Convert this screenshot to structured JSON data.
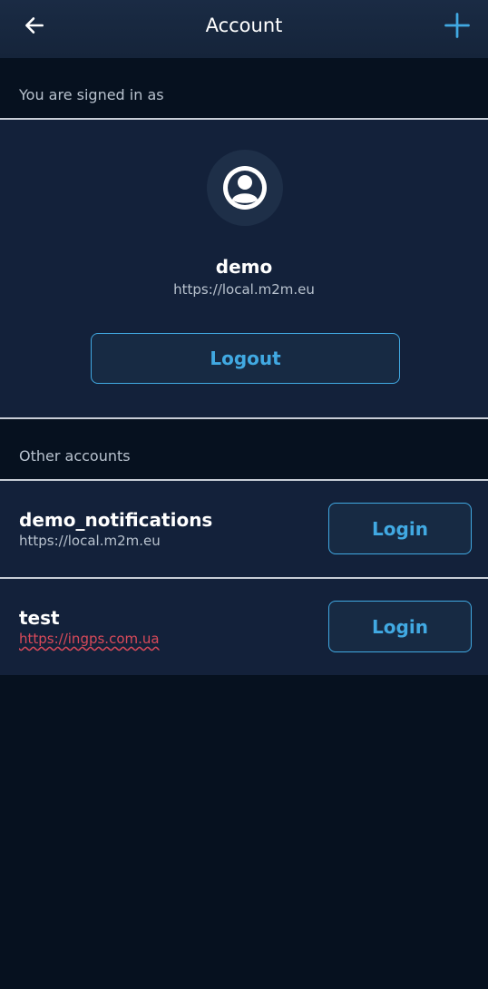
{
  "app_bar": {
    "title": "Account",
    "back_icon": "arrow-left-icon",
    "add_icon": "plus-icon"
  },
  "signed_in": {
    "header": "You are signed in as",
    "avatar_icon": "account-circle-icon",
    "name": "demo",
    "url": "https://local.m2m.eu",
    "logout_label": "Logout"
  },
  "other_accounts": {
    "header": "Other accounts",
    "items": [
      {
        "name": "demo_notifications",
        "url": "https://local.m2m.eu",
        "login_label": "Login"
      },
      {
        "name": "test",
        "url": "https://ingps.com.ua",
        "login_label": "Login"
      }
    ]
  },
  "colors": {
    "accent": "#41a9e2",
    "background": "#06111f",
    "panel": "#13213a",
    "app_bar": "#1a2b44",
    "secondary_text": "#b8c2ce",
    "error_underline": "#d94a5a"
  }
}
